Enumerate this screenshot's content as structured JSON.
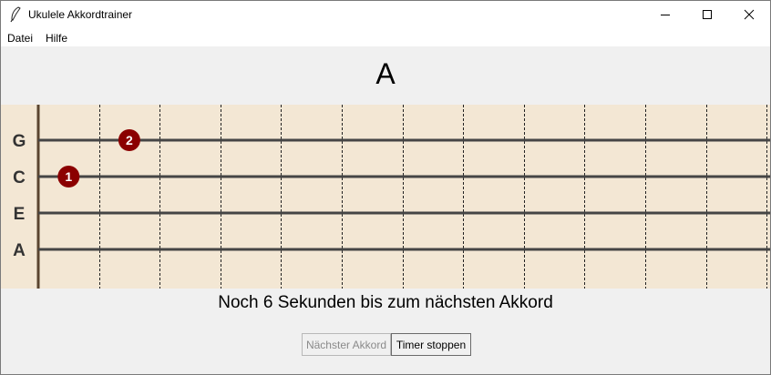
{
  "window": {
    "title": "Ukulele Akkordtrainer",
    "controls": {
      "minimize": "minimize-icon",
      "maximize": "maximize-icon",
      "close": "close-icon"
    }
  },
  "menu": {
    "items": [
      "Datei",
      "Hilfe"
    ]
  },
  "chord": {
    "name": "A"
  },
  "fretboard": {
    "background": "#f3e7d4",
    "dot_color": "#8b0000",
    "strings": [
      "G",
      "C",
      "E",
      "A"
    ],
    "fret_count": 12,
    "fingers": [
      {
        "string": "G",
        "fret": 2,
        "label": "2"
      },
      {
        "string": "C",
        "fret": 1,
        "label": "1"
      }
    ]
  },
  "status": {
    "countdown": "Noch 6 Sekunden bis zum nächsten Akkord"
  },
  "buttons": {
    "next": "Nächster Akkord",
    "stop": "Timer stoppen"
  }
}
